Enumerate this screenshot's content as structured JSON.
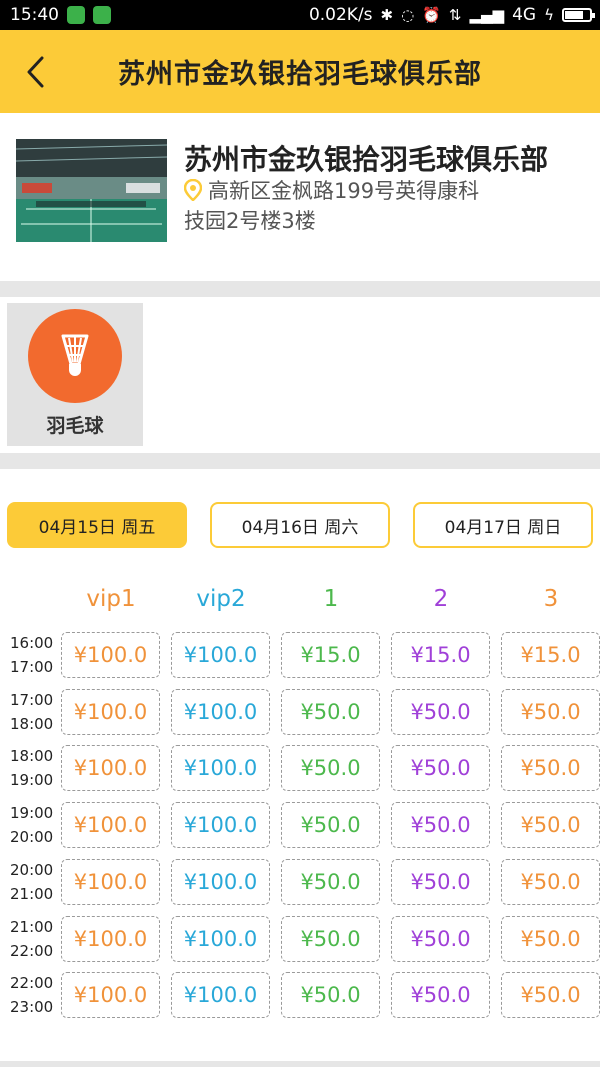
{
  "status_bar": {
    "time": "15:40",
    "network_speed": "0.02K/s",
    "network_type": "4G",
    "battery_level": 0.75
  },
  "header": {
    "title": "苏州市金玖银拾羽毛球俱乐部",
    "back_icon": "chevron-left-icon"
  },
  "venue": {
    "name": "苏州市金玖银拾羽毛球俱乐部",
    "address_line1": "高新区金枫路199号英得康科",
    "address_line2": "技园2号楼3楼",
    "pin_color": "#fccb38"
  },
  "sports": [
    {
      "label": "羽毛球",
      "icon": "shuttlecock-icon",
      "color": "#f26a2e"
    }
  ],
  "dates": [
    {
      "label": "04月15日 周五",
      "selected": true
    },
    {
      "label": "04月16日 周六",
      "selected": false
    },
    {
      "label": "04月17日 周日",
      "selected": false
    }
  ],
  "courts": [
    {
      "name": "vip1",
      "color": "#f0923a"
    },
    {
      "name": "vip2",
      "color": "#29a8d8"
    },
    {
      "name": "1",
      "color": "#4cb84c"
    },
    {
      "name": "2",
      "color": "#a040d8"
    },
    {
      "name": "3",
      "color": "#f0923a"
    }
  ],
  "slots": [
    {
      "start": "16:00",
      "end": "17:00",
      "prices": [
        "¥100.0",
        "¥100.0",
        "¥15.0",
        "¥15.0",
        "¥15.0"
      ]
    },
    {
      "start": "17:00",
      "end": "18:00",
      "prices": [
        "¥100.0",
        "¥100.0",
        "¥50.0",
        "¥50.0",
        "¥50.0"
      ]
    },
    {
      "start": "18:00",
      "end": "19:00",
      "prices": [
        "¥100.0",
        "¥100.0",
        "¥50.0",
        "¥50.0",
        "¥50.0"
      ]
    },
    {
      "start": "19:00",
      "end": "20:00",
      "prices": [
        "¥100.0",
        "¥100.0",
        "¥50.0",
        "¥50.0",
        "¥50.0"
      ]
    },
    {
      "start": "20:00",
      "end": "21:00",
      "prices": [
        "¥100.0",
        "¥100.0",
        "¥50.0",
        "¥50.0",
        "¥50.0"
      ]
    },
    {
      "start": "21:00",
      "end": "22:00",
      "prices": [
        "¥100.0",
        "¥100.0",
        "¥50.0",
        "¥50.0",
        "¥50.0"
      ]
    },
    {
      "start": "22:00",
      "end": "23:00",
      "prices": [
        "¥100.0",
        "¥100.0",
        "¥50.0",
        "¥50.0",
        "¥50.0"
      ]
    }
  ]
}
